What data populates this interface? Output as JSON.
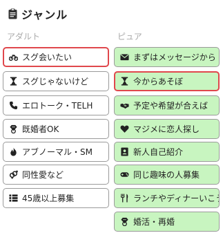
{
  "header": {
    "title": "ジャンル",
    "icon": "clipboard-icon"
  },
  "columns": {
    "adult_label": "アダルト",
    "pure_label": "ピュア"
  },
  "adult_items": [
    {
      "label": "スグ会いたい",
      "icon": "motorcycle-icon",
      "selected": true
    },
    {
      "label": "スグじゃないけど",
      "icon": "hourglass-icon",
      "selected": false
    },
    {
      "label": "エロトーク・TELH",
      "icon": "phone-icon",
      "selected": false
    },
    {
      "label": "既婚者OK",
      "icon": "diamond-ring-icon",
      "selected": false
    },
    {
      "label": "アブノーマル・SM",
      "icon": "flame-icon",
      "selected": false
    },
    {
      "label": "同性愛など",
      "icon": "venus-mars-icon",
      "selected": false
    },
    {
      "label": "45歳以上募集",
      "icon": "list-icon",
      "selected": false
    }
  ],
  "pure_items": [
    {
      "label": "まずはメッセージから",
      "icon": "envelope-icon",
      "selected": false
    },
    {
      "label": "今からあそぼ",
      "icon": "hourglass-icon",
      "selected": true
    },
    {
      "label": "予定や希望が合えば",
      "icon": "handshake-icon",
      "selected": false
    },
    {
      "label": "マジメに恋人探し",
      "icon": "heart-icon",
      "selected": false
    },
    {
      "label": "新人自己紹介",
      "icon": "id-card-icon",
      "selected": false
    },
    {
      "label": "同じ趣味の人募集",
      "icon": "gamepad-icon",
      "selected": false
    },
    {
      "label": "ランチやディナーいこう",
      "icon": "utensils-icon",
      "selected": false
    },
    {
      "label": "婚活・再婚",
      "icon": "diamond-ring-icon",
      "selected": false
    }
  ],
  "colors": {
    "pure_bg": "#c8f5c0",
    "selected_border": "#e0474c",
    "border": "#9a9a9a"
  }
}
